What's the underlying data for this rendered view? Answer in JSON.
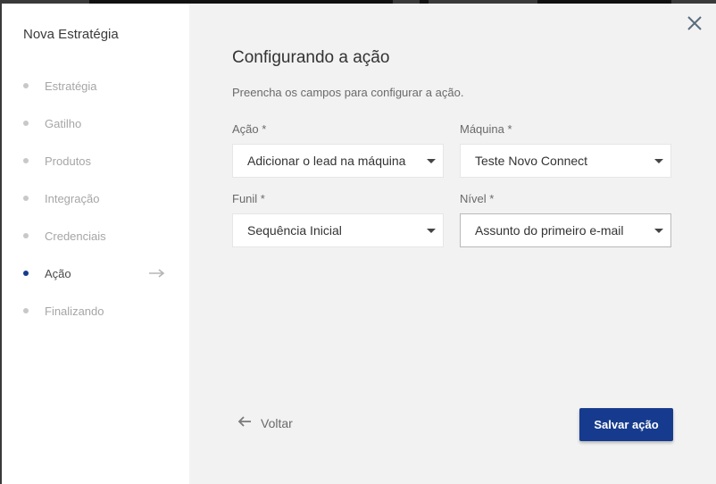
{
  "colors": {
    "accent": "#163b8e",
    "inactive_dot": "#c8c8c8",
    "sidebar_bg": "#ffffff",
    "main_bg": "#f2f2f2"
  },
  "sidebar": {
    "title": "Nova Estratégia",
    "steps": [
      {
        "label": "Estratégia",
        "active": false
      },
      {
        "label": "Gatilho",
        "active": false
      },
      {
        "label": "Produtos",
        "active": false
      },
      {
        "label": "Integração",
        "active": false
      },
      {
        "label": "Credenciais",
        "active": false
      },
      {
        "label": "Ação",
        "active": true
      },
      {
        "label": "Finalizando",
        "active": false
      }
    ]
  },
  "main": {
    "title": "Configurando a ação",
    "subtitle": "Preencha os campos para configurar a ação.",
    "fields": {
      "acao": {
        "label": "Ação *",
        "value": "Adicionar o lead na máquina"
      },
      "maquina": {
        "label": "Máquina *",
        "value": "Teste Novo Connect"
      },
      "funil": {
        "label": "Funil *",
        "value": "Sequência Inicial"
      },
      "nivel": {
        "label": "Nível *",
        "value": "Assunto do primeiro e-mail"
      }
    },
    "back_label": "Voltar",
    "save_label": "Salvar ação",
    "icons": {
      "close": "close-icon",
      "back": "arrow-left-icon",
      "active_step": "arrow-right-icon",
      "dropdown": "caret-down-icon"
    }
  }
}
